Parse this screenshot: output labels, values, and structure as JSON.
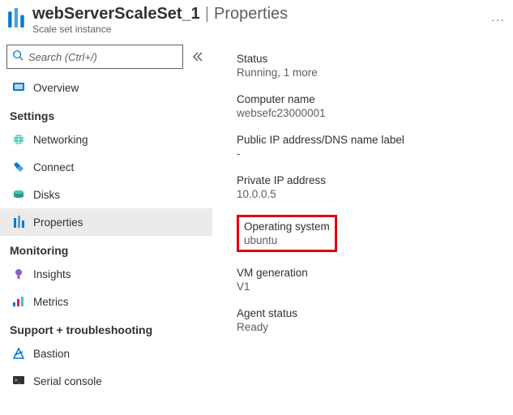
{
  "header": {
    "resource_name": "webServerScaleSet_1",
    "separator": "|",
    "page_title": "Properties",
    "subtitle": "Scale set instance",
    "more": "···"
  },
  "search": {
    "placeholder": "Search (Ctrl+/)"
  },
  "sidebar": {
    "items": [
      {
        "label": "Overview",
        "icon": "overview-icon",
        "active": false
      }
    ],
    "sections": [
      {
        "title": "Settings",
        "items": [
          {
            "label": "Networking",
            "icon": "networking-icon",
            "active": false
          },
          {
            "label": "Connect",
            "icon": "connect-icon",
            "active": false
          },
          {
            "label": "Disks",
            "icon": "disks-icon",
            "active": false
          },
          {
            "label": "Properties",
            "icon": "properties-icon",
            "active": true
          }
        ]
      },
      {
        "title": "Monitoring",
        "items": [
          {
            "label": "Insights",
            "icon": "insights-icon",
            "active": false
          },
          {
            "label": "Metrics",
            "icon": "metrics-icon",
            "active": false
          }
        ]
      },
      {
        "title": "Support + troubleshooting",
        "items": [
          {
            "label": "Bastion",
            "icon": "bastion-icon",
            "active": false
          },
          {
            "label": "Serial console",
            "icon": "serial-console-icon",
            "active": false
          }
        ]
      }
    ]
  },
  "properties": {
    "status": {
      "label": "Status",
      "value": "Running, 1 more"
    },
    "computer_name": {
      "label": "Computer name",
      "value": "websefc23000001"
    },
    "public_ip": {
      "label": "Public IP address/DNS name label",
      "value": "-"
    },
    "private_ip": {
      "label": "Private IP address",
      "value": "10.0.0.5"
    },
    "operating_system": {
      "label": "Operating system",
      "value": "ubuntu",
      "highlighted": true
    },
    "vm_generation": {
      "label": "VM generation",
      "value": "V1"
    },
    "agent_status": {
      "label": "Agent status",
      "value": "Ready"
    }
  }
}
